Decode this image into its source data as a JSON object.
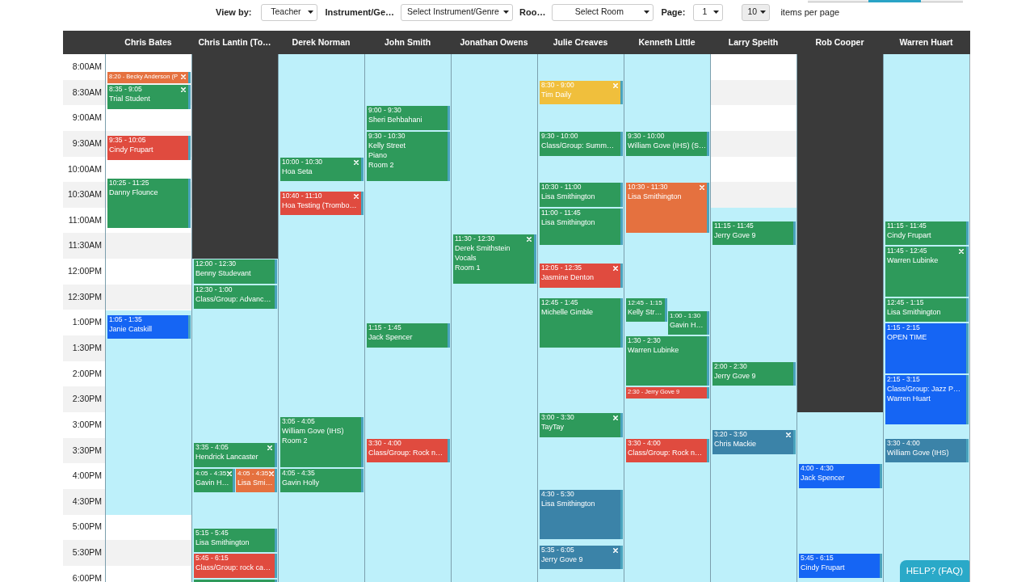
{
  "tabs_cut_off": [
    {
      "selected": false
    },
    {
      "selected": true
    },
    {
      "selected": false
    }
  ],
  "filters": [
    {
      "label": "View by:",
      "value": "Teacher"
    },
    {
      "label": "Instrument/Ge…",
      "value": "Select Instrument/Genre"
    },
    {
      "label": "Roo…",
      "value": "Select Room"
    },
    {
      "label": "Page:",
      "value": "1"
    }
  ],
  "per_page": {
    "value": "10",
    "label": "items per page"
  },
  "schedule": {
    "times": [
      "8:00AM",
      "8:30AM",
      "9:00AM",
      "9:30AM",
      "10:00AM",
      "10:30AM",
      "11:00AM",
      "11:30AM",
      "12:00PM",
      "12:30PM",
      "1:00PM",
      "1:30PM",
      "2:00PM",
      "2:30PM",
      "3:00PM",
      "3:30PM",
      "4:00PM",
      "4:30PM",
      "5:00PM",
      "5:30PM",
      "6:00PM"
    ],
    "columns": [
      {
        "name": "Chris Bates",
        "slots": [
          {
            "kind": "closed"
          },
          {
            "kind": "closed"
          },
          {
            "kind": "closed"
          },
          {
            "kind": "closed"
          },
          {
            "kind": "closed"
          },
          {
            "kind": "closed"
          },
          {
            "kind": "closed"
          },
          {
            "kind": "closed"
          },
          {
            "kind": "closed"
          },
          {
            "kind": "closed"
          },
          {
            "kind": "open"
          },
          {
            "kind": "open"
          },
          {
            "kind": "open"
          },
          {
            "kind": "open"
          },
          {
            "kind": "open"
          },
          {
            "kind": "open"
          },
          {
            "kind": "open"
          },
          {
            "kind": "open"
          },
          {
            "kind": "closed"
          },
          {
            "kind": "closed"
          },
          {
            "kind": "closed"
          }
        ],
        "events": [
          {
            "kind": "compact",
            "text": "8:20 - Becky Anderson (P",
            "color": "#e5713f",
            "removable": true
          },
          {
            "kind": "block",
            "time": "8:35 - 9:05",
            "lines": [
              "Trial Student"
            ],
            "color": "#2e9a5b",
            "removable": true
          },
          {
            "kind": "block",
            "time": "9:35 - 10:05",
            "lines": [
              "Cindy Frupart"
            ],
            "color": "#e04b3f",
            "removable": false
          },
          {
            "kind": "block",
            "time": "10:25 - 11:25",
            "lines": [
              "Danny Flounce"
            ],
            "color": "#2e9a5b",
            "removable": false
          },
          {
            "kind": "block",
            "time": "1:05 - 1:35",
            "lines": [
              "Janie Catskill"
            ],
            "color": "#1565f4",
            "removable": false
          }
        ]
      },
      {
        "name": "Chris Lantin (To…",
        "slots": [
          {
            "kind": "off"
          },
          {
            "kind": "off"
          },
          {
            "kind": "off"
          },
          {
            "kind": "off"
          },
          {
            "kind": "off"
          },
          {
            "kind": "off"
          },
          {
            "kind": "off"
          },
          {
            "kind": "off"
          },
          {
            "kind": "open"
          },
          {
            "kind": "open"
          },
          {
            "kind": "open"
          },
          {
            "kind": "open"
          },
          {
            "kind": "open"
          },
          {
            "kind": "open"
          },
          {
            "kind": "open"
          },
          {
            "kind": "open"
          },
          {
            "kind": "open"
          },
          {
            "kind": "open"
          },
          {
            "kind": "open"
          },
          {
            "kind": "open"
          },
          {
            "kind": "open"
          }
        ],
        "events": [
          {
            "kind": "block",
            "time": "12:00 - 12:30",
            "lines": [
              "Benny Studevant"
            ],
            "color": "#2e9a5b",
            "removable": false
          },
          {
            "kind": "block",
            "time": "12:30 - 1:00",
            "lines": [
              "Class/Group: Advanc…"
            ],
            "color": "#2e9a5b",
            "removable": false
          },
          {
            "kind": "block",
            "time": "3:35 - 4:05",
            "lines": [
              "Hendrick Lancaster"
            ],
            "color": "#2e9a5b",
            "removable": true
          },
          {
            "kind": "left",
            "time": "4:05 - 4:35",
            "lines": [
              "Gavin H…"
            ],
            "color": "#2e9a5b",
            "removable": true
          },
          {
            "kind": "right",
            "time": "4:05 - 4:35",
            "lines": [
              "Lisa Smi…"
            ],
            "color": "#e5713f",
            "removable": true
          },
          {
            "kind": "block",
            "time": "5:15 - 5:45",
            "lines": [
              "Lisa Smithington"
            ],
            "color": "#2e9a5b",
            "removable": false
          },
          {
            "kind": "block",
            "time": "5:45 - 6:15",
            "lines": [
              "Class/Group: rock ca…"
            ],
            "color": "#e04b3f",
            "removable": false
          },
          {
            "kind": "clipped",
            "color": "#2e9a5b"
          }
        ]
      },
      {
        "name": "Derek Norman",
        "slots": [
          {
            "kind": "open"
          },
          {
            "kind": "open"
          },
          {
            "kind": "open"
          },
          {
            "kind": "open"
          },
          {
            "kind": "open"
          },
          {
            "kind": "open"
          },
          {
            "kind": "open"
          },
          {
            "kind": "open"
          },
          {
            "kind": "open"
          },
          {
            "kind": "open"
          },
          {
            "kind": "open"
          },
          {
            "kind": "open"
          },
          {
            "kind": "open"
          },
          {
            "kind": "open"
          },
          {
            "kind": "open"
          },
          {
            "kind": "open"
          },
          {
            "kind": "open"
          },
          {
            "kind": "open"
          },
          {
            "kind": "open"
          },
          {
            "kind": "open"
          },
          {
            "kind": "open"
          }
        ],
        "events": [
          {
            "kind": "block",
            "time": "10:00 - 10:30",
            "lines": [
              "Hoa Seta"
            ],
            "color": "#2e9a5b",
            "removable": true
          },
          {
            "kind": "block",
            "time": "10:40 - 11:10",
            "lines": [
              "Hoa Testing (Trombo…"
            ],
            "color": "#e04b3f",
            "removable": true
          },
          {
            "kind": "block",
            "time": "3:05 - 4:05",
            "lines": [
              "William Gove (IHS)",
              "Room 2"
            ],
            "color": "#2e9a5b",
            "removable": false
          },
          {
            "kind": "block",
            "time": "4:05 - 4:35",
            "lines": [
              "Gavin Holly"
            ],
            "color": "#2e9a5b",
            "removable": false
          }
        ]
      },
      {
        "name": "John Smith",
        "slots": [
          {
            "kind": "open"
          },
          {
            "kind": "open"
          },
          {
            "kind": "open"
          },
          {
            "kind": "open"
          },
          {
            "kind": "open"
          },
          {
            "kind": "open"
          },
          {
            "kind": "open"
          },
          {
            "kind": "open"
          },
          {
            "kind": "open"
          },
          {
            "kind": "open"
          },
          {
            "kind": "open"
          },
          {
            "kind": "open"
          },
          {
            "kind": "open"
          },
          {
            "kind": "open"
          },
          {
            "kind": "open"
          },
          {
            "kind": "open"
          },
          {
            "kind": "open"
          },
          {
            "kind": "open"
          },
          {
            "kind": "open"
          },
          {
            "kind": "open"
          },
          {
            "kind": "open"
          }
        ],
        "events": [
          {
            "kind": "block",
            "time": "9:00 - 9:30",
            "lines": [
              "Sheri Behbahani"
            ],
            "color": "#2e9a5b",
            "removable": false
          },
          {
            "kind": "block",
            "time": "9:30 - 10:30",
            "lines": [
              "Kelly Street",
              "Piano",
              "Room 2"
            ],
            "color": "#2e9a5b",
            "removable": false
          },
          {
            "kind": "block",
            "time": "1:15 - 1:45",
            "lines": [
              "Jack Spencer"
            ],
            "color": "#2e9a5b",
            "removable": false
          },
          {
            "kind": "block",
            "time": "3:30 - 4:00",
            "lines": [
              "Class/Group: Rock n…"
            ],
            "color": "#e04b3f",
            "removable": false
          }
        ]
      },
      {
        "name": "Jonathan Owens",
        "slots": [
          {
            "kind": "open"
          },
          {
            "kind": "open"
          },
          {
            "kind": "open"
          },
          {
            "kind": "open"
          },
          {
            "kind": "open"
          },
          {
            "kind": "open"
          },
          {
            "kind": "open"
          },
          {
            "kind": "open"
          },
          {
            "kind": "open"
          },
          {
            "kind": "open"
          },
          {
            "kind": "open"
          },
          {
            "kind": "open"
          },
          {
            "kind": "open"
          },
          {
            "kind": "open"
          },
          {
            "kind": "open"
          },
          {
            "kind": "open"
          },
          {
            "kind": "open"
          },
          {
            "kind": "open"
          },
          {
            "kind": "open"
          },
          {
            "kind": "open"
          },
          {
            "kind": "open"
          }
        ],
        "events": [
          {
            "kind": "block",
            "time": "11:30 - 12:30",
            "lines": [
              "Derek Smithstein",
              "Vocals",
              "Room 1"
            ],
            "color": "#2e9a5b",
            "removable": true
          }
        ]
      },
      {
        "name": "Julie Creaves",
        "slots": [
          {
            "kind": "open"
          },
          {
            "kind": "open"
          },
          {
            "kind": "open"
          },
          {
            "kind": "open"
          },
          {
            "kind": "open"
          },
          {
            "kind": "open"
          },
          {
            "kind": "open"
          },
          {
            "kind": "open"
          },
          {
            "kind": "open"
          },
          {
            "kind": "open"
          },
          {
            "kind": "open"
          },
          {
            "kind": "open"
          },
          {
            "kind": "open"
          },
          {
            "kind": "open"
          },
          {
            "kind": "open"
          },
          {
            "kind": "open"
          },
          {
            "kind": "open"
          },
          {
            "kind": "open"
          },
          {
            "kind": "open"
          },
          {
            "kind": "open"
          },
          {
            "kind": "open"
          }
        ],
        "events": [
          {
            "kind": "block",
            "time": "8:30 - 9:00",
            "lines": [
              "Tim Daily"
            ],
            "color": "#f0bf3c",
            "removable": true
          },
          {
            "kind": "block",
            "time": "9:30 - 10:00",
            "lines": [
              "Class/Group: Summ…"
            ],
            "color": "#2e9a5b",
            "removable": false
          },
          {
            "kind": "block",
            "time": "10:30 - 11:00",
            "lines": [
              "Lisa Smithington"
            ],
            "color": "#2e9a5b",
            "removable": false
          },
          {
            "kind": "block",
            "time": "11:00 - 11:45",
            "lines": [
              "Lisa Smithington"
            ],
            "color": "#2e9a5b",
            "removable": false
          },
          {
            "kind": "block",
            "time": "12:05 - 12:35",
            "lines": [
              "Jasmine Denton"
            ],
            "color": "#e04b3f",
            "removable": true
          },
          {
            "kind": "block",
            "time": "12:45 - 1:45",
            "lines": [
              "Michelle Gimble"
            ],
            "color": "#2e9a5b",
            "removable": false
          },
          {
            "kind": "block",
            "time": "3:00 - 3:30",
            "lines": [
              "TayTay"
            ],
            "color": "#2e9a5b",
            "removable": true
          },
          {
            "kind": "block",
            "time": "4:30 - 5:30",
            "lines": [
              "Lisa Smithington"
            ],
            "color": "#3b83a8",
            "removable": false
          },
          {
            "kind": "block",
            "time": "5:35 - 6:05",
            "lines": [
              "Jerry Gove 9"
            ],
            "color": "#3b83a8",
            "removable": true
          }
        ]
      },
      {
        "name": "Kenneth Little",
        "slots": [
          {
            "kind": "open"
          },
          {
            "kind": "open"
          },
          {
            "kind": "open"
          },
          {
            "kind": "open"
          },
          {
            "kind": "open"
          },
          {
            "kind": "open"
          },
          {
            "kind": "open"
          },
          {
            "kind": "open"
          },
          {
            "kind": "open"
          },
          {
            "kind": "open"
          },
          {
            "kind": "open"
          },
          {
            "kind": "open"
          },
          {
            "kind": "open"
          },
          {
            "kind": "open"
          },
          {
            "kind": "open"
          },
          {
            "kind": "open"
          },
          {
            "kind": "open"
          },
          {
            "kind": "open"
          },
          {
            "kind": "open"
          },
          {
            "kind": "open"
          },
          {
            "kind": "open"
          }
        ],
        "events": [
          {
            "kind": "block",
            "time": "9:30 - 10:00",
            "lines": [
              "William Gove (IHS) (S…"
            ],
            "color": "#2e9a5b",
            "removable": false
          },
          {
            "kind": "block",
            "time": "10:30 - 11:30",
            "lines": [
              "Lisa Smithington"
            ],
            "color": "#e5713f",
            "removable": true
          },
          {
            "kind": "left",
            "time": "12:45 - 1:15",
            "lines": [
              "Kelly Str…"
            ],
            "color": "#2e9a5b",
            "removable": false
          },
          {
            "kind": "right",
            "time": "1:00 - 1:30",
            "lines": [
              "Gavin H…"
            ],
            "color": "#2e9a5b",
            "removable": false
          },
          {
            "kind": "block",
            "time": "1:30 - 2:30",
            "lines": [
              "Warren Lubinke"
            ],
            "color": "#2e9a5b",
            "removable": false
          },
          {
            "kind": "compact",
            "text": "2:30 - Jerry Gove 9",
            "color": "#e04b3f",
            "removable": false
          },
          {
            "kind": "block",
            "time": "3:30 - 4:00",
            "lines": [
              "Class/Group: Rock n…"
            ],
            "color": "#e04b3f",
            "removable": false
          }
        ]
      },
      {
        "name": "Larry Speith",
        "slots": [
          {
            "kind": "closed"
          },
          {
            "kind": "closed"
          },
          {
            "kind": "closed"
          },
          {
            "kind": "closed"
          },
          {
            "kind": "closed"
          },
          {
            "kind": "closed"
          },
          {
            "kind": "open"
          },
          {
            "kind": "open"
          },
          {
            "kind": "open"
          },
          {
            "kind": "open"
          },
          {
            "kind": "open"
          },
          {
            "kind": "open"
          },
          {
            "kind": "open"
          },
          {
            "kind": "open"
          },
          {
            "kind": "open"
          },
          {
            "kind": "open"
          },
          {
            "kind": "open"
          },
          {
            "kind": "open"
          },
          {
            "kind": "open"
          },
          {
            "kind": "open"
          },
          {
            "kind": "open"
          }
        ],
        "events": [
          {
            "kind": "block",
            "time": "11:15 - 11:45",
            "lines": [
              "Jerry Gove 9"
            ],
            "color": "#2e9a5b",
            "removable": false
          },
          {
            "kind": "block",
            "time": "2:00 - 2:30",
            "lines": [
              "Jerry Gove 9"
            ],
            "color": "#2e9a5b",
            "removable": false
          },
          {
            "kind": "block",
            "time": "3:20 - 3:50",
            "lines": [
              "Chris Mackie"
            ],
            "color": "#3b83a8",
            "removable": true
          }
        ]
      },
      {
        "name": "Rob Cooper",
        "slots": [
          {
            "kind": "off"
          },
          {
            "kind": "off"
          },
          {
            "kind": "off"
          },
          {
            "kind": "off"
          },
          {
            "kind": "off"
          },
          {
            "kind": "off"
          },
          {
            "kind": "off"
          },
          {
            "kind": "off"
          },
          {
            "kind": "off"
          },
          {
            "kind": "off"
          },
          {
            "kind": "off"
          },
          {
            "kind": "off"
          },
          {
            "kind": "off"
          },
          {
            "kind": "off"
          },
          {
            "kind": "open"
          },
          {
            "kind": "open"
          },
          {
            "kind": "open"
          },
          {
            "kind": "open"
          },
          {
            "kind": "open"
          },
          {
            "kind": "open"
          },
          {
            "kind": "open"
          }
        ],
        "events": [
          {
            "kind": "block",
            "time": "4:00 - 4:30",
            "lines": [
              "Jack Spencer"
            ],
            "color": "#1565f4",
            "removable": false
          },
          {
            "kind": "block",
            "time": "5:45 - 6:15",
            "lines": [
              "Cindy Frupart"
            ],
            "color": "#1565f4",
            "removable": false
          }
        ]
      },
      {
        "name": "Warren Huart",
        "slots": [
          {
            "kind": "open"
          },
          {
            "kind": "open"
          },
          {
            "kind": "open"
          },
          {
            "kind": "open"
          },
          {
            "kind": "open"
          },
          {
            "kind": "open"
          },
          {
            "kind": "open"
          },
          {
            "kind": "open"
          },
          {
            "kind": "open"
          },
          {
            "kind": "open"
          },
          {
            "kind": "open"
          },
          {
            "kind": "open"
          },
          {
            "kind": "open"
          },
          {
            "kind": "open"
          },
          {
            "kind": "open"
          },
          {
            "kind": "open"
          },
          {
            "kind": "open"
          },
          {
            "kind": "open"
          },
          {
            "kind": "open"
          },
          {
            "kind": "open"
          },
          {
            "kind": "open"
          }
        ],
        "events": [
          {
            "kind": "block",
            "time": "11:15 - 11:45",
            "lines": [
              "Cindy Frupart"
            ],
            "color": "#2e9a5b",
            "removable": false
          },
          {
            "kind": "block",
            "time": "11:45 - 12:45",
            "lines": [
              "Warren Lubinke"
            ],
            "color": "#2e9a5b",
            "removable": true
          },
          {
            "kind": "block",
            "time": "12:45 - 1:15",
            "lines": [
              "Lisa Smithington"
            ],
            "color": "#2e9a5b",
            "removable": false
          },
          {
            "kind": "block",
            "time": "1:15 - 2:15",
            "lines": [
              "OPEN TIME"
            ],
            "color": "#1565f4",
            "removable": false
          },
          {
            "kind": "block",
            "time": "2:15 - 3:15",
            "lines": [
              "Class/Group: Jazz P…",
              "Warren Huart"
            ],
            "color": "#1565f4",
            "removable": false
          },
          {
            "kind": "block",
            "time": "3:30 - 4:00",
            "lines": [
              "William Gove (IHS)"
            ],
            "color": "#3b83a8",
            "removable": false
          }
        ]
      }
    ]
  },
  "help_button": "HELP? (FAQ)"
}
